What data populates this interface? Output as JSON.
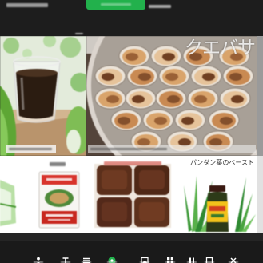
{
  "hero": {
    "title": "クエバサ"
  },
  "products": {
    "pandan": {
      "label": "パンダン葉のペースト"
    }
  },
  "nav": {
    "active_index": 3,
    "items": [
      {
        "icon": "person-icon"
      },
      {
        "icon": "text-icon"
      },
      {
        "icon": "menu-icon"
      },
      {
        "icon": "record-icon"
      },
      {
        "icon": "image-icon"
      },
      {
        "icon": "grid-icon"
      },
      {
        "icon": "pause-icon"
      },
      {
        "icon": "square-icon"
      },
      {
        "icon": "close-icon"
      }
    ]
  },
  "colors": {
    "accent_green": "#22b14c",
    "topbar": "#1d1d1d",
    "navbar": "#1a1a1a"
  }
}
